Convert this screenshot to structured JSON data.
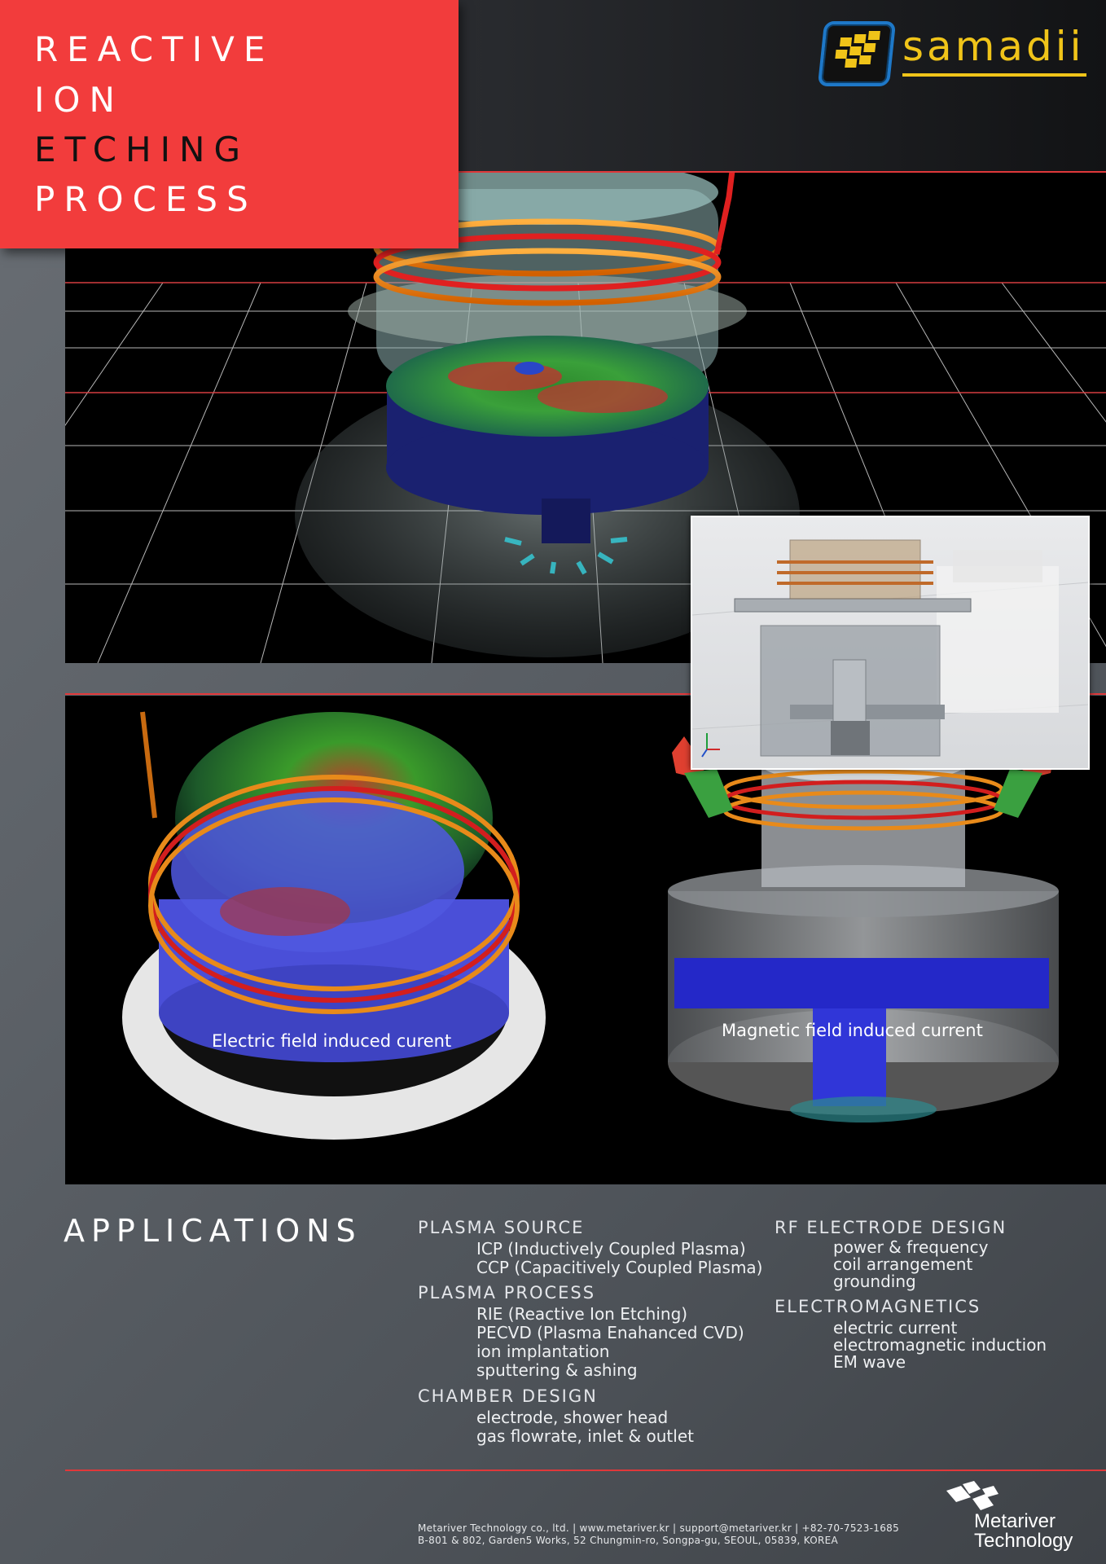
{
  "title": {
    "lines": [
      "REACTIVE",
      "ION",
      "ETCHING",
      "PROCESS"
    ]
  },
  "brand": {
    "logo_text": "samadii",
    "accent": "#f0c419",
    "mark_border": "#1e78c8"
  },
  "colors": {
    "title_box": "#f23c3c",
    "rule": "#e0383a",
    "heading_text": "#ffffff"
  },
  "captions": {
    "electric": "Electric field induced curent",
    "magnetic": "Magnetic field induced current"
  },
  "applications": {
    "heading": "APPLICATIONS",
    "plasma_source": {
      "label": "PLASMA SOURCE",
      "items": [
        "ICP (Inductively Coupled Plasma)",
        "CCP (Capacitively Coupled Plasma)"
      ]
    },
    "plasma_process": {
      "label": "PLASMA PROCESS",
      "items": [
        "RIE (Reactive Ion Etching)",
        "PECVD (Plasma Enahanced CVD)",
        "ion implantation",
        "sputtering & ashing"
      ]
    },
    "chamber_design": {
      "label": "CHAMBER DESIGN",
      "items": [
        "electrode, shower head",
        "gas flowrate, inlet & outlet"
      ]
    },
    "rf_electrode": {
      "label": "RF ELECTRODE DESIGN",
      "items": [
        "power & frequency",
        "coil arrangement",
        "grounding"
      ]
    },
    "electromagnetics": {
      "label": "ELECTROMAGNETICS",
      "items": [
        "electric current",
        "electromagnetic induction",
        "EM wave"
      ]
    }
  },
  "footer": {
    "line1": "Metariver Technology co., ltd. | www.metariver.kr | support@metariver.kr | +82-70-7523-1685",
    "line2": "B-801 & 802, Garden5 Works, 52 Chungmin-ro, Songpa-gu, SEOUL, 05839, KOREA",
    "company_line1": "Metariver",
    "company_line2": "Technology"
  }
}
